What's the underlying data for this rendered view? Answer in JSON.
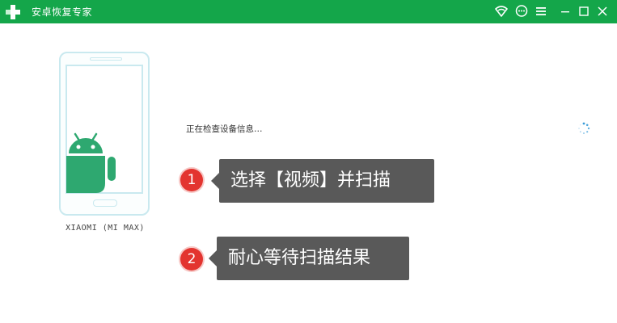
{
  "app": {
    "title": "安卓恢复专家",
    "logo_icon": "plus-cross-logo",
    "accent": "#14a64a"
  },
  "titlebar_icons": [
    "wifi-signal-icon",
    "chat-bubble-icon",
    "menu-icon",
    "minimize-icon",
    "maximize-icon",
    "close-icon"
  ],
  "device": {
    "name": "XIAOMI (MI MAX)"
  },
  "status": {
    "text": "正在检查设备信息…"
  },
  "steps": [
    {
      "number": "1",
      "text": "选择【视频】并扫描"
    },
    {
      "number": "2",
      "text": "耐心等待扫描结果"
    }
  ],
  "colors": {
    "step_badge": "#e3342f",
    "callout_bg": "#595959",
    "phone_outline": "#c9e9ef",
    "android_green": "#2ea870"
  }
}
